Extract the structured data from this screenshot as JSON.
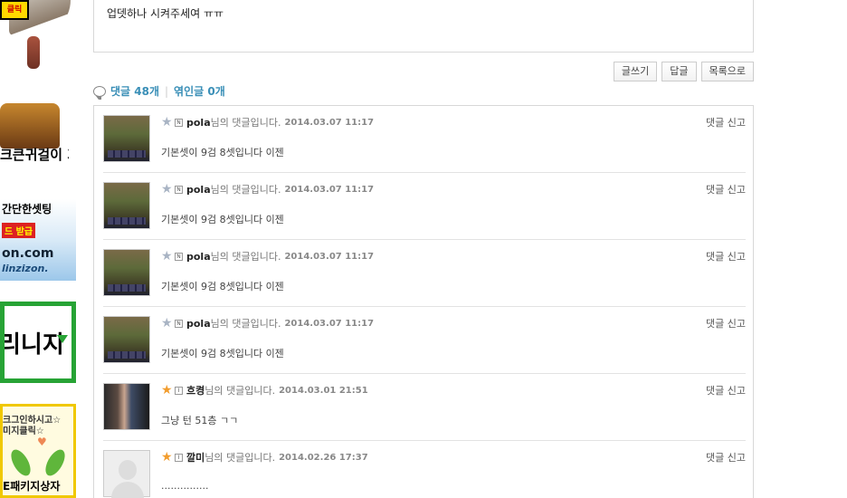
{
  "sidebar": {
    "banner1": {
      "mark": "클릭"
    },
    "banner2": {
      "text": "크큰귀걸이 가요"
    },
    "banner3": {
      "line1": "간단한셋팅",
      "badge": "드 받급",
      "line2": "on.com",
      "line3": "linzizon."
    },
    "banner4": {
      "text": "리니지"
    },
    "banner5": {
      "line1": "크그인하시고☆",
      "line2": "미지클릭☆",
      "line3": "E패키지상자"
    }
  },
  "post": {
    "text": "업뎃하나 시켜주세여 ㅠㅠ"
  },
  "buttons": {
    "write": "글쓰기",
    "reply": "답글",
    "list": "목록으로"
  },
  "counts": {
    "comments": "댓글 48개",
    "trackbacks": "엮인글 0개"
  },
  "actions": {
    "reply": "댓글",
    "report": "신고"
  },
  "comments": [
    {
      "author": "pola",
      "suffix": "님의 댓글입니다.",
      "date": "2014.03.07 11:17",
      "text": "기본셋이 9검 8셋입니다 이젠",
      "avatar": "game",
      "star": "silver"
    },
    {
      "author": "pola",
      "suffix": "님의 댓글입니다.",
      "date": "2014.03.07 11:17",
      "text": "기본셋이 9검 8셋입니다 이젠",
      "avatar": "game",
      "star": "silver"
    },
    {
      "author": "pola",
      "suffix": "님의 댓글입니다.",
      "date": "2014.03.07 11:17",
      "text": "기본셋이 9검 8셋입니다 이젠",
      "avatar": "game",
      "star": "silver"
    },
    {
      "author": "pola",
      "suffix": "님의 댓글입니다.",
      "date": "2014.03.07 11:17",
      "text": "기본셋이 9검 8셋입니다 이젠",
      "avatar": "game",
      "star": "silver"
    },
    {
      "author": "흐켱",
      "suffix": "님의 댓글입니다.",
      "date": "2014.03.01 21:51",
      "text": "그냥 턴 51층 ㄱㄱ",
      "avatar": "photo",
      "star": "gold"
    },
    {
      "author": "깔미",
      "suffix": "님의 댓글입니다.",
      "date": "2014.02.26 17:37",
      "text": "...............",
      "avatar": "empty",
      "star": "gold"
    }
  ]
}
